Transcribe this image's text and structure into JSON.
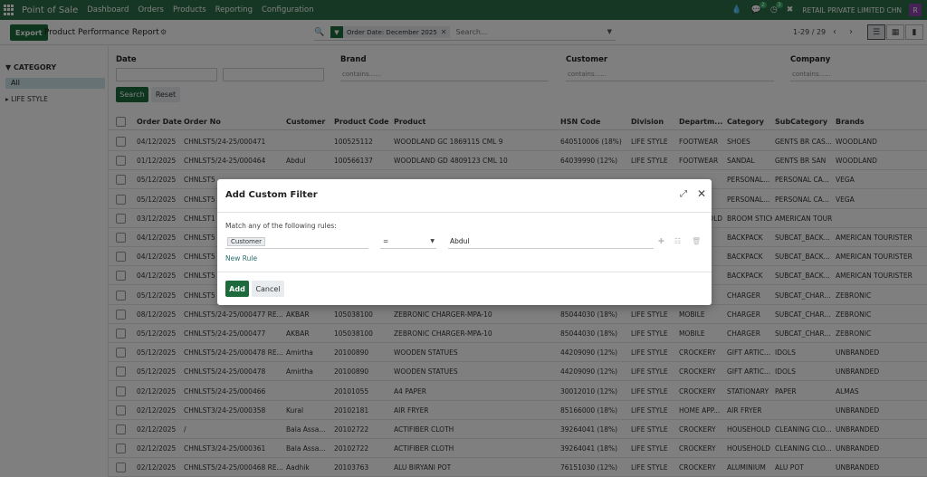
{
  "navbar": {
    "brand": "Point of Sale",
    "menu": [
      "Dashboard",
      "Orders",
      "Products",
      "Reporting",
      "Configuration"
    ],
    "chat_badge": "2",
    "activity_badge": "3",
    "company": "RETAIL PRIVATE LIMITED CHN",
    "avatar_letter": "R"
  },
  "control": {
    "export_label": "Export",
    "title": "Product Performance Report",
    "facet": "Order Date: December 2025",
    "search_placeholder": "Search...",
    "pager": "1-29 / 29"
  },
  "sidebar": {
    "heading": "CATEGORY",
    "all_label": "All",
    "items": [
      "LIFE STYLE"
    ]
  },
  "filters": {
    "date_label": "Date",
    "brand_label": "Brand",
    "brand_placeholder": "contains......",
    "customer_label": "Customer",
    "customer_placeholder": "contains......",
    "company_label": "Company",
    "company_placeholder": "contains......",
    "search_button": "Search",
    "reset_button": "Reset"
  },
  "table": {
    "columns": [
      "Order Date",
      "Order No",
      "Customer",
      "Product Code",
      "Product",
      "HSN Code",
      "Division",
      "Departm...",
      "Category",
      "SubCategory",
      "Brands"
    ],
    "rows": [
      [
        "04/12/2025",
        "CHNLST5/24-25/000471",
        "",
        "100525112",
        "WOODLAND GC 1869115 CML 9",
        "64051000​6 (18%)",
        "LIFE STYLE",
        "FOOTWEAR",
        "SHOES",
        "GENTS BR CAS...",
        "WOODLAND"
      ],
      [
        "01/12/2025",
        "CHNLST5/24-25/000464",
        "Abdul",
        "100566137",
        "WOODLAND GD 4809123 CML 10",
        "64039990 (12%)",
        "LIFE STYLE",
        "FOOTWEAR",
        "SANDAL",
        "GENTS BR SAN",
        "WOODLAND"
      ],
      [
        "05/12/2025",
        "CHNLST5",
        "",
        "",
        "",
        "",
        "",
        "",
        "PERSONAL...",
        "PERSONAL CA...",
        "VEGA"
      ],
      [
        "05/12/2025",
        "CHNLST5",
        "",
        "",
        "",
        "",
        "",
        "",
        "PERSONAL...",
        "PERSONAL CA...",
        "VEGA"
      ],
      [
        "03/12/2025",
        "CHNLST1",
        "",
        "",
        "",
        "",
        "",
        "HOUSEHOLD",
        "BROOM STICK",
        "AMERICAN TOURISTER",
        ""
      ],
      [
        "04/12/2025",
        "CHNLST5",
        "",
        "",
        "",
        "",
        "",
        "",
        "BACKPACK",
        "SUBCAT_BACK...",
        "AMERICAN TOURISTER"
      ],
      [
        "04/12/2025",
        "CHNLST5",
        "",
        "",
        "",
        "",
        "",
        "",
        "BACKPACK",
        "SUBCAT_BACK...",
        "AMERICAN TOURISTER"
      ],
      [
        "04/12/2025",
        "CHNLST5",
        "",
        "",
        "",
        "",
        "",
        "",
        "BACKPACK",
        "SUBCAT_BACK...",
        "AMERICAN TOURISTER"
      ],
      [
        "05/12/2025",
        "CHNLST5",
        "",
        "",
        "",
        "",
        "",
        "",
        "CHARGER",
        "SUBCAT_CHAR...",
        "ZEBRONIC"
      ],
      [
        "08/12/2025",
        "CHNLST5/24-25/000477 RE...",
        "AKBAR",
        "105038100",
        "ZEBRONIC CHARGER-MPA-10",
        "85044030 (18%)",
        "LIFE STYLE",
        "MOBILE",
        "CHARGER",
        "SUBCAT_CHAR...",
        "ZEBRONIC"
      ],
      [
        "05/12/2025",
        "CHNLST5/24-25/000477",
        "AKBAR",
        "105038100",
        "ZEBRONIC CHARGER-MPA-10",
        "85044030 (18%)",
        "LIFE STYLE",
        "MOBILE",
        "CHARGER",
        "SUBCAT_CHAR...",
        "ZEBRONIC"
      ],
      [
        "05/12/2025",
        "CHNLST5/24-25/000478 RE...",
        "Amirtha",
        "20100890",
        "WOODEN STATUES",
        "44209090 (12%)",
        "LIFE STYLE",
        "CROCKERY",
        "GIFT ARTIC...",
        "IDOLS",
        "UNBRANDED"
      ],
      [
        "05/12/2025",
        "CHNLST5/24-25/000478",
        "Amirtha",
        "20100890",
        "WOODEN STATUES",
        "44209090 (12%)",
        "LIFE STYLE",
        "CROCKERY",
        "GIFT ARTIC...",
        "IDOLS",
        "UNBRANDED"
      ],
      [
        "02/12/2025",
        "CHNLST5/24-25/000466",
        "",
        "20101055",
        "A4 PAPER",
        "30012010 (12%)",
        "LIFE STYLE",
        "CROCKERY",
        "STATIONARY",
        "PAPER",
        "ALMAS"
      ],
      [
        "02/12/2025",
        "CHNLST3/24-25/000358",
        "Kural",
        "20102181",
        "AIR FRYER",
        "85166000 (18%)",
        "LIFE STYLE",
        "HOME APP...",
        "AIR FRYER",
        "",
        "UNBRANDED"
      ],
      [
        "02/12/2025",
        "/",
        "Bala Assa...",
        "20102722",
        "ACTIFIBER CLOTH",
        "39264041 (18%)",
        "LIFE STYLE",
        "CROCKERY",
        "HOUSEHOLD",
        "CLEANING CLO...",
        "UNBRANDED"
      ],
      [
        "02/12/2025",
        "CHNLST3/24-25/000361",
        "Bala Assa...",
        "20102722",
        "ACTIFIBER CLOTH",
        "39264041 (18%)",
        "LIFE STYLE",
        "CROCKERY",
        "HOUSEHOLD",
        "CLEANING CLO...",
        "UNBRANDED"
      ],
      [
        "02/12/2025",
        "CHNLST5/24-25/000468 RE...",
        "Aadhik",
        "20103763",
        "ALU BIRYANI POT",
        "76151030 (12%)",
        "LIFE STYLE",
        "CROCKERY",
        "ALUMINIUM",
        "ALU POT",
        "UNBRANDED"
      ]
    ]
  },
  "modal": {
    "title": "Add Custom Filter",
    "rules_label": "Match any of the following rules:",
    "rule_field": "Customer",
    "rule_operator": "=",
    "rule_value": "Abdul",
    "new_rule": "New Rule",
    "add_button": "Add",
    "cancel_button": "Cancel"
  }
}
